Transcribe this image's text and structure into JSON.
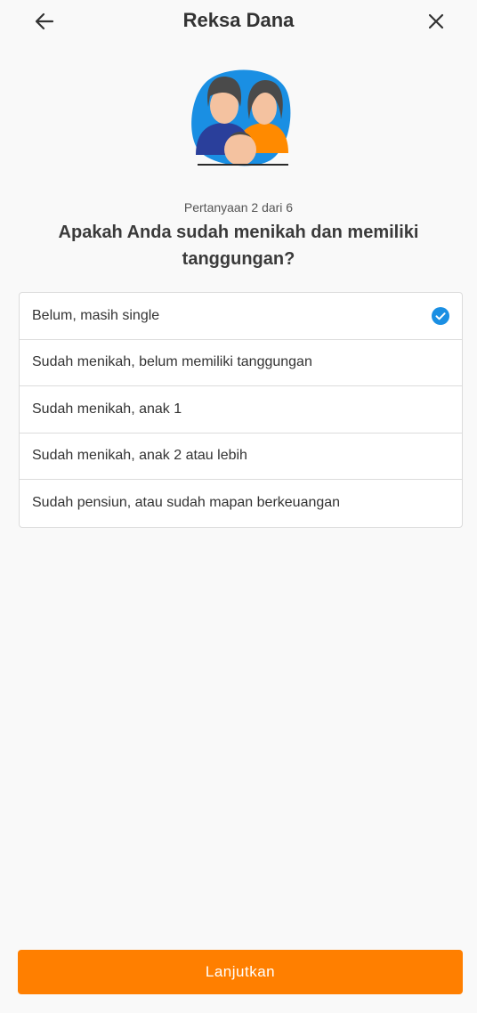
{
  "header": {
    "title": "Reksa Dana",
    "back_icon": "arrow-left-icon",
    "close_icon": "close-icon"
  },
  "progress": "Pertanyaan 2 dari 6",
  "question": "Apakah Anda sudah menikah dan memiliki tanggungan?",
  "options": [
    {
      "label": "Belum, masih single",
      "selected": true
    },
    {
      "label": "Sudah menikah, belum memiliki tanggungan",
      "selected": false
    },
    {
      "label": "Sudah menikah, anak 1",
      "selected": false
    },
    {
      "label": "Sudah menikah, anak 2 atau lebih",
      "selected": false
    },
    {
      "label": "Sudah pensiun, atau sudah mapan berkeuangan",
      "selected": false
    }
  ],
  "cta": {
    "label": "Lanjutkan"
  },
  "colors": {
    "accent": "#ff7f00",
    "check": "#1a8fe3",
    "illustration_blob": "#1a8fe3"
  }
}
